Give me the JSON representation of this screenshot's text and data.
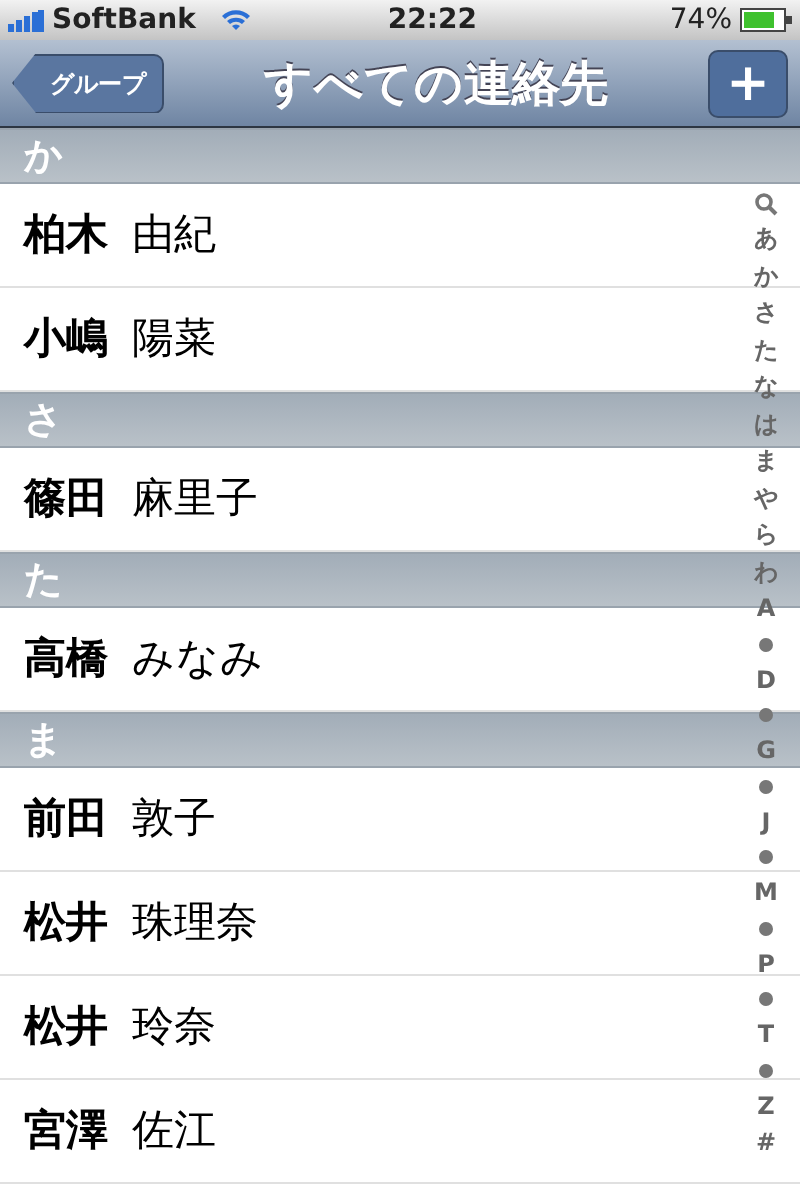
{
  "status_bar": {
    "carrier": "SoftBank",
    "time": "22:22",
    "battery": "74%"
  },
  "nav_bar": {
    "back": "グループ",
    "title": "すべての連絡先",
    "add": "+"
  },
  "sections": [
    {
      "header": "か",
      "contacts": [
        {
          "last": "柏木",
          "first": "由紀"
        },
        {
          "last": "小嶋",
          "first": "陽菜"
        }
      ]
    },
    {
      "header": "さ",
      "contacts": [
        {
          "last": "篠田",
          "first": "麻里子"
        }
      ]
    },
    {
      "header": "た",
      "contacts": [
        {
          "last": "高橋",
          "first": "みなみ"
        }
      ]
    },
    {
      "header": "ま",
      "contacts": [
        {
          "last": "前田",
          "first": "敦子"
        },
        {
          "last": "松井",
          "first": "珠理奈"
        },
        {
          "last": "松井",
          "first": "玲奈"
        },
        {
          "last": "宮澤",
          "first": "佐江"
        }
      ]
    }
  ],
  "index": [
    {
      "kind": "search"
    },
    {
      "kind": "letter",
      "label": "あ"
    },
    {
      "kind": "letter",
      "label": "か"
    },
    {
      "kind": "letter",
      "label": "さ"
    },
    {
      "kind": "letter",
      "label": "た"
    },
    {
      "kind": "letter",
      "label": "な"
    },
    {
      "kind": "letter",
      "label": "は"
    },
    {
      "kind": "letter",
      "label": "ま"
    },
    {
      "kind": "letter",
      "label": "や"
    },
    {
      "kind": "letter",
      "label": "ら"
    },
    {
      "kind": "letter",
      "label": "わ"
    },
    {
      "kind": "letter",
      "label": "A"
    },
    {
      "kind": "dot"
    },
    {
      "kind": "letter",
      "label": "D"
    },
    {
      "kind": "dot"
    },
    {
      "kind": "letter",
      "label": "G"
    },
    {
      "kind": "dot"
    },
    {
      "kind": "letter",
      "label": "J"
    },
    {
      "kind": "dot"
    },
    {
      "kind": "letter",
      "label": "M"
    },
    {
      "kind": "dot"
    },
    {
      "kind": "letter",
      "label": "P"
    },
    {
      "kind": "dot"
    },
    {
      "kind": "letter",
      "label": "T"
    },
    {
      "kind": "dot"
    },
    {
      "kind": "letter",
      "label": "Z"
    },
    {
      "kind": "letter",
      "label": "#"
    }
  ]
}
